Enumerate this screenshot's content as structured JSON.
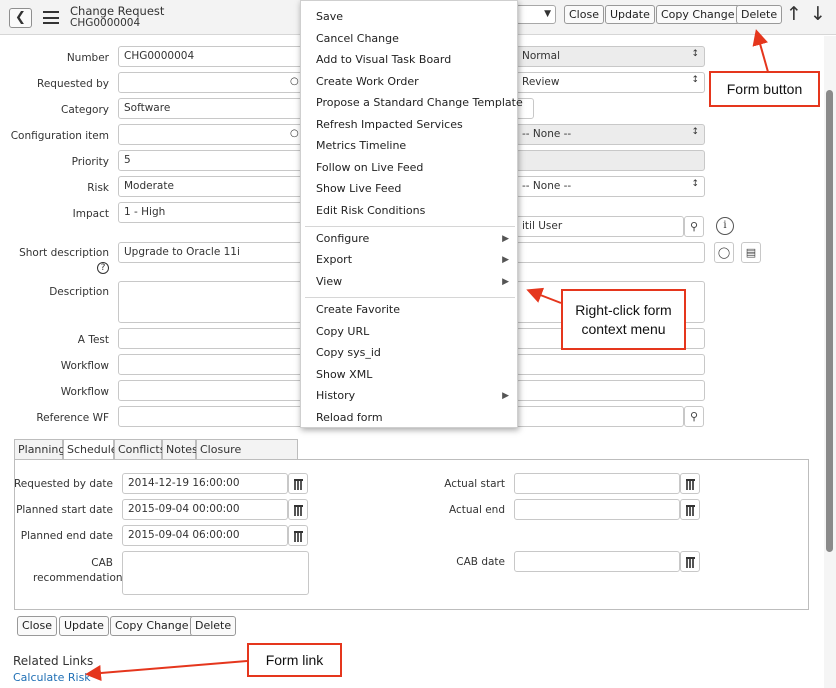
{
  "header": {
    "title": "Change Request",
    "record_number": "CHG0000004",
    "buttons": {
      "close": "Close",
      "update": "Update",
      "copy_change": "Copy Change",
      "delete": "Delete"
    }
  },
  "form": {
    "number": {
      "label": "Number",
      "value": "CHG0000004"
    },
    "requested_by": {
      "label": "Requested by",
      "value": ""
    },
    "category": {
      "label": "Category",
      "value": "Software"
    },
    "configuration_item": {
      "label": "Configuration item",
      "value": ""
    },
    "priority": {
      "label": "Priority",
      "value": "5"
    },
    "risk": {
      "label": "Risk",
      "value": "Moderate"
    },
    "impact": {
      "label": "Impact",
      "value": "1 - High"
    },
    "short_description": {
      "label": "Short description",
      "value": "Upgrade to Oracle 11i"
    },
    "description": {
      "label": "Description"
    },
    "a_test": {
      "label": "A Test"
    },
    "workflow1": {
      "label": "Workflow"
    },
    "workflow2": {
      "label": "Workflow"
    },
    "reference_wf": {
      "label": "Reference WF"
    },
    "right": {
      "type": "Normal",
      "state": "Review",
      "approval_none": "-- None --",
      "review_none": "-- None --",
      "assigned_to": "itil User"
    }
  },
  "tabs": [
    "Planning",
    "Schedule",
    "Conflicts",
    "Notes",
    "Closure Information"
  ],
  "schedule": {
    "requested_by_date": {
      "label": "Requested by date",
      "value": "2014-12-19 16:00:00"
    },
    "planned_start_date": {
      "label": "Planned start date",
      "value": "2015-09-04 00:00:00"
    },
    "planned_end_date": {
      "label": "Planned end date",
      "value": "2015-09-04 06:00:00"
    },
    "cab_recommendation": {
      "label": "CAB recommendation"
    },
    "actual_start": {
      "label": "Actual start",
      "value": ""
    },
    "actual_end": {
      "label": "Actual end",
      "value": ""
    },
    "cab_date": {
      "label": "CAB date",
      "value": ""
    }
  },
  "bottom_buttons": {
    "close": "Close",
    "update": "Update",
    "copy_change": "Copy Change",
    "delete": "Delete"
  },
  "related_links": {
    "title": "Related Links",
    "calculate_risk": "Calculate Risk"
  },
  "context_menu": {
    "items": [
      "Save",
      "Cancel Change",
      "Add to Visual Task Board",
      "Create Work Order",
      "Propose a Standard Change Template",
      "Refresh Impacted Services",
      "Metrics Timeline",
      "Follow on Live Feed",
      "Show Live Feed",
      "Edit Risk Conditions",
      "Configure",
      "Export",
      "View",
      "Create Favorite",
      "Copy URL",
      "Copy sys_id",
      "Show XML",
      "History",
      "Reload form"
    ]
  },
  "annotations": {
    "form_button": "Form button",
    "context_menu": "Right-click form context menu",
    "form_link": "Form link"
  },
  "colors": {
    "accent_red": "#e5361d",
    "link_blue": "#1f6fb5"
  },
  "icons": [
    "back-arrow-icon",
    "hamburger-menu-icon",
    "up-arrow-icon",
    "down-arrow-icon",
    "search-icon",
    "info-icon",
    "lightbulb-icon",
    "template-icon",
    "calendar-icon",
    "help-icon",
    "chevron-right-icon"
  ]
}
